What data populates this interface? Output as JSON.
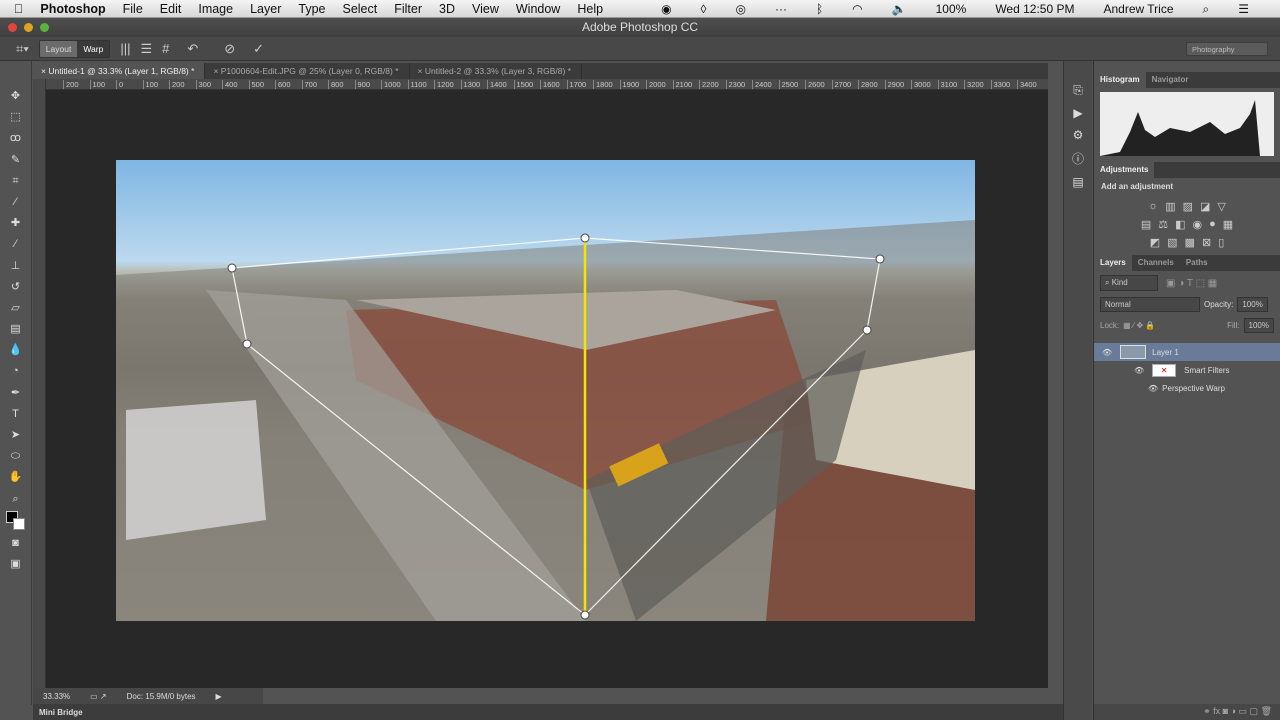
{
  "menubar": {
    "app": "Photoshop",
    "items": [
      "File",
      "Edit",
      "Image",
      "Layer",
      "Type",
      "Select",
      "Filter",
      "3D",
      "View",
      "Window",
      "Help"
    ],
    "battery": "100%",
    "clock": "Wed 12:50 PM",
    "user": "Andrew Trice"
  },
  "window": {
    "title": "Adobe Photoshop CC"
  },
  "options": {
    "layout": "Layout",
    "warp": "Warp",
    "workspace": "Photography"
  },
  "tabs": [
    {
      "label": "Untitled-1 @ 33.3% (Layer 1, RGB/8) *"
    },
    {
      "label": "P1000604-Edit.JPG @ 25% (Layer 0, RGB/8) *"
    },
    {
      "label": "Untitled-2 @ 33.3% (Layer 3, RGB/8) *"
    }
  ],
  "ruler": [
    "200",
    "100",
    "0",
    "100",
    "200",
    "300",
    "400",
    "500",
    "600",
    "700",
    "800",
    "900",
    "1000",
    "1100",
    "1200",
    "1300",
    "1400",
    "1500",
    "1600",
    "1700",
    "1800",
    "1900",
    "2000",
    "2100",
    "2200",
    "2300",
    "2400",
    "2500",
    "2600",
    "2700",
    "2800",
    "2900",
    "3000",
    "3100",
    "3200",
    "3300",
    "3400"
  ],
  "status": {
    "zoom": "33.33%",
    "doc": "Doc: 15.9M/0 bytes"
  },
  "minibridge": "Mini Bridge",
  "panels": {
    "histogram_tabs": [
      "Histogram",
      "Navigator"
    ],
    "adjustments": {
      "tab": "Adjustments",
      "heading": "Add an adjustment"
    },
    "layers_tabs": [
      "Layers",
      "Channels",
      "Paths"
    ],
    "kind": "Kind",
    "blend": "Normal",
    "opacity_label": "Opacity:",
    "opacity": "100%",
    "lock_label": "Lock:",
    "fill_label": "Fill:",
    "fill": "100%",
    "layers": [
      {
        "name": "Layer 1"
      },
      {
        "name": "Smart Filters"
      },
      {
        "name": "Perspective Warp"
      }
    ]
  },
  "tools": [
    "move",
    "marquee",
    "lasso",
    "quick-select",
    "crop",
    "eyedropper",
    "healing",
    "brush",
    "clone-stamp",
    "history-brush",
    "eraser",
    "gradient",
    "blur",
    "dodge",
    "pen",
    "type",
    "path-select",
    "ellipse",
    "hand",
    "zoom"
  ],
  "colors": {
    "warp_pin_line": "#f2e600",
    "accent": "#6a7a99"
  }
}
